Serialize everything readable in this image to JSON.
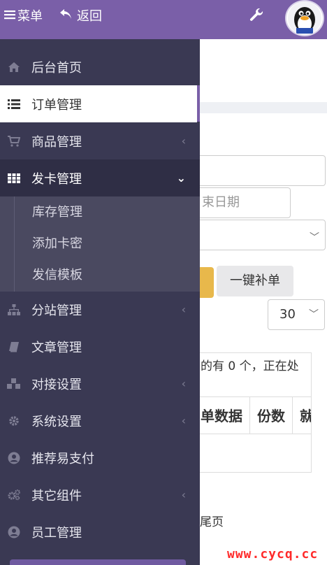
{
  "topbar": {
    "menu_label": "菜单",
    "back_label": "返回"
  },
  "sidebar": {
    "items": [
      {
        "label": "后台首页",
        "icon": "home-icon"
      },
      {
        "label": "订单管理",
        "icon": "list-icon",
        "active": true
      },
      {
        "label": "商品管理",
        "icon": "cart-icon",
        "has_children": true
      },
      {
        "label": "发卡管理",
        "icon": "grid-icon",
        "has_children": true,
        "open": true
      },
      {
        "label": "分站管理",
        "icon": "sitemap-icon",
        "has_children": true
      },
      {
        "label": "文章管理",
        "icon": "book-icon"
      },
      {
        "label": "对接设置",
        "icon": "cubes-icon",
        "has_children": true
      },
      {
        "label": "系统设置",
        "icon": "gear-icon",
        "has_children": true
      },
      {
        "label": "推荐易支付",
        "icon": "user-circle-icon"
      },
      {
        "label": "其它组件",
        "icon": "gears-icon",
        "has_children": true
      },
      {
        "label": "员工管理",
        "icon": "user-circle-icon"
      }
    ],
    "submenu": [
      "库存管理",
      "添加卡密",
      "发信模板"
    ]
  },
  "main": {
    "date_placeholder": "束日期",
    "one_click_btn": "一键补单",
    "page_size": "30",
    "hint_text": "的有 0 个，正在处",
    "table_headers": [
      "单数据",
      "份数",
      "就"
    ],
    "last_page": "尾页"
  },
  "watermark": "www.cycq.cc",
  "colors": {
    "header": "#7a5fa8",
    "sidebar_bg": "#3a3953",
    "submenu_bg": "#4a4960",
    "accent_yellow": "#e8b84b",
    "watermark": "#ff2a2a"
  }
}
